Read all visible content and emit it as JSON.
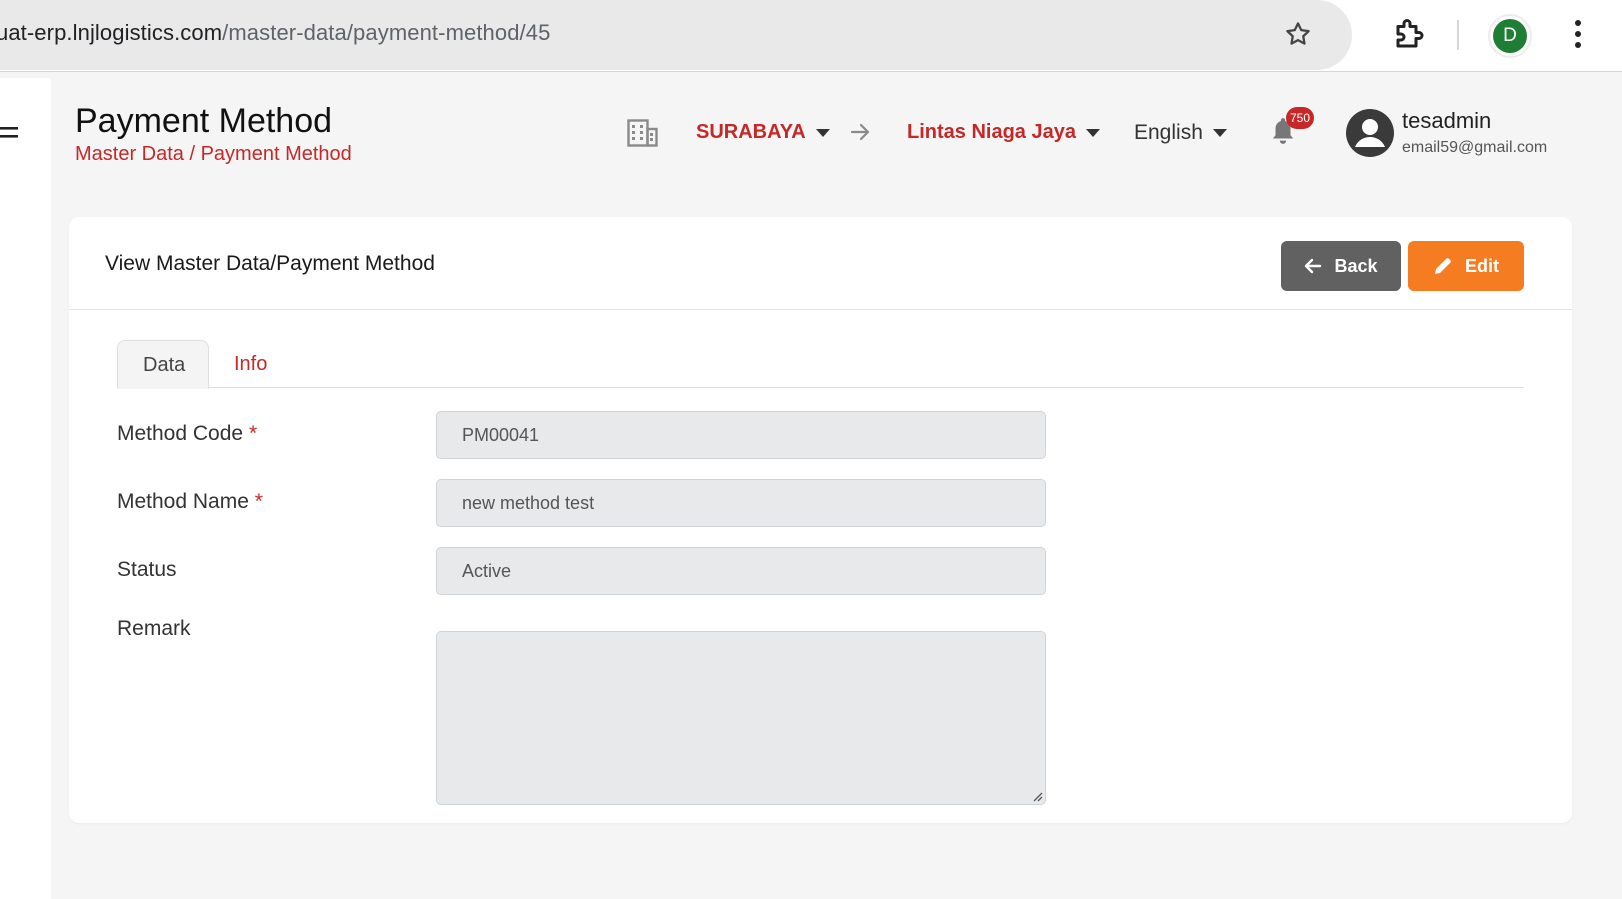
{
  "browser": {
    "url_host": "uat-erp.lnjlogistics.com",
    "url_path": "/master-data/payment-method/45",
    "profile_initial": "D"
  },
  "header": {
    "title": "Payment Method",
    "breadcrumb": "Master Data / Payment Method",
    "branch": "SURABAYA",
    "company": "Lintas Niaga Jaya",
    "language": "English",
    "notification_count": "750",
    "user_name": "tesadmin",
    "user_email": "email59@gmail.com"
  },
  "card": {
    "title": "View Master Data/Payment Method",
    "back_label": "Back",
    "edit_label": "Edit"
  },
  "tabs": [
    {
      "label": "Data",
      "active": true
    },
    {
      "label": "Info",
      "active": false
    }
  ],
  "form": {
    "method_code": {
      "label": "Method Code",
      "required_mark": "*",
      "value": "PM00041"
    },
    "method_name": {
      "label": "Method Name",
      "required_mark": "*",
      "value": "new method test"
    },
    "status": {
      "label": "Status",
      "value": "Active"
    },
    "remark": {
      "label": "Remark",
      "value": ""
    }
  },
  "colors": {
    "accent_red": "#c62828",
    "edit_orange": "#f57c20",
    "back_gray": "#616161",
    "field_bg": "#e8e9eb"
  }
}
